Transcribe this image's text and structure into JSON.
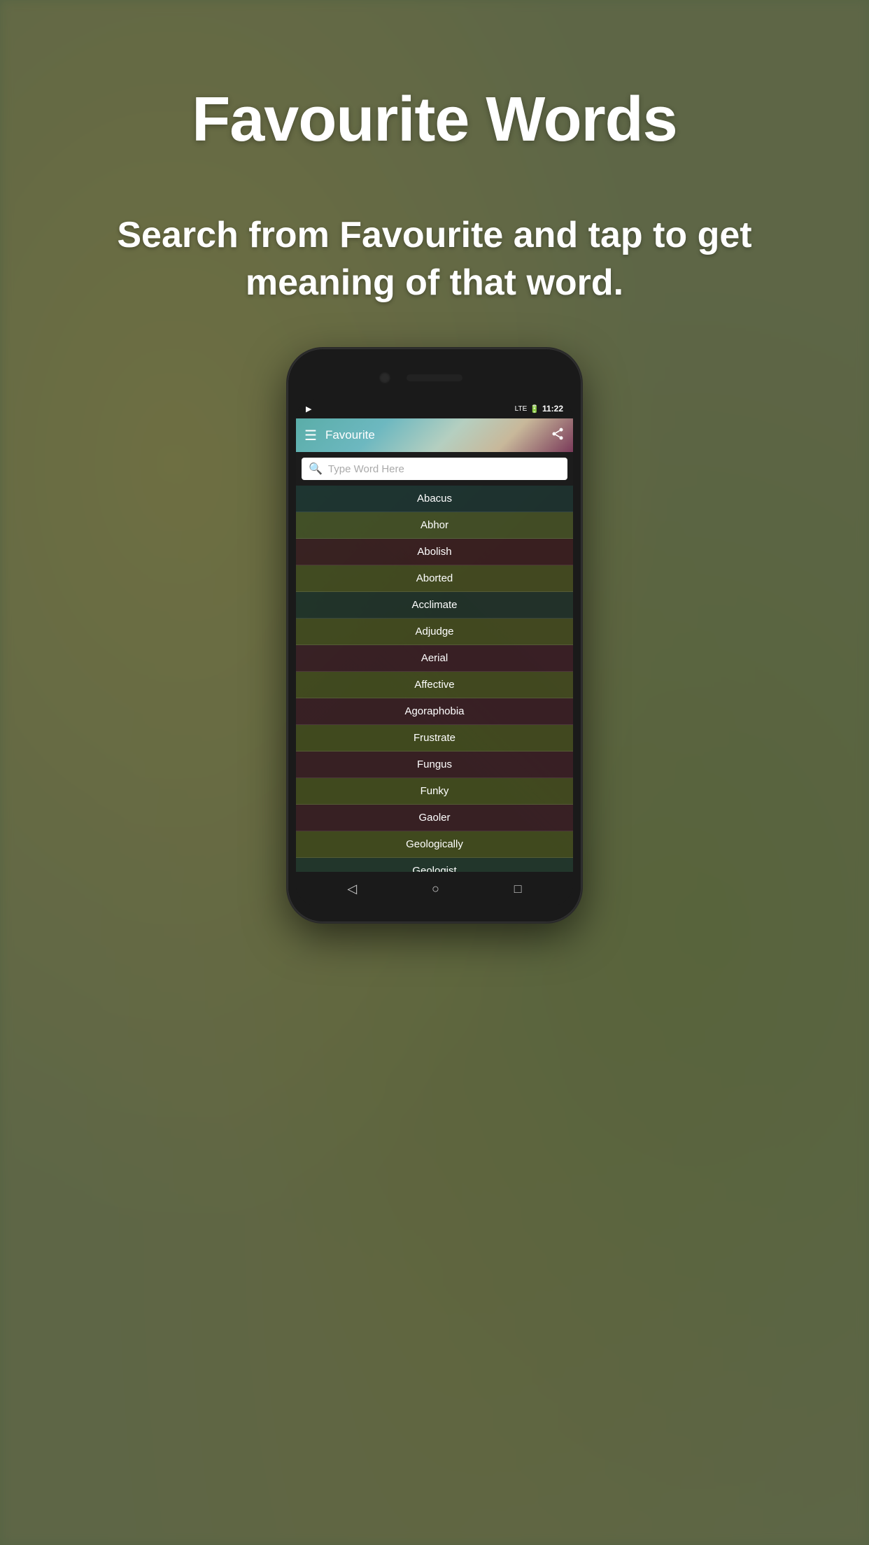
{
  "page": {
    "title": "Favourite Words",
    "subtitle": "Search from Favourite and tap to get meaning of that word."
  },
  "toolbar": {
    "title": "Favourite",
    "menu_label": "☰",
    "share_label": "⎋"
  },
  "search": {
    "placeholder": "Type Word Here"
  },
  "status_bar": {
    "play_icon": "▶",
    "signal": "LTE",
    "time": "11:22"
  },
  "words": [
    "Abacus",
    "Abhor",
    "Abolish",
    "Aborted",
    "Acclimate",
    "Adjudge",
    "Aerial",
    "Affective",
    "Agoraphobia",
    "Frustrate",
    "Fungus",
    "Funky",
    "Gaoler",
    "Geologically",
    "Geologist"
  ],
  "nav": {
    "back": "◁",
    "home": "○",
    "recent": "□"
  }
}
